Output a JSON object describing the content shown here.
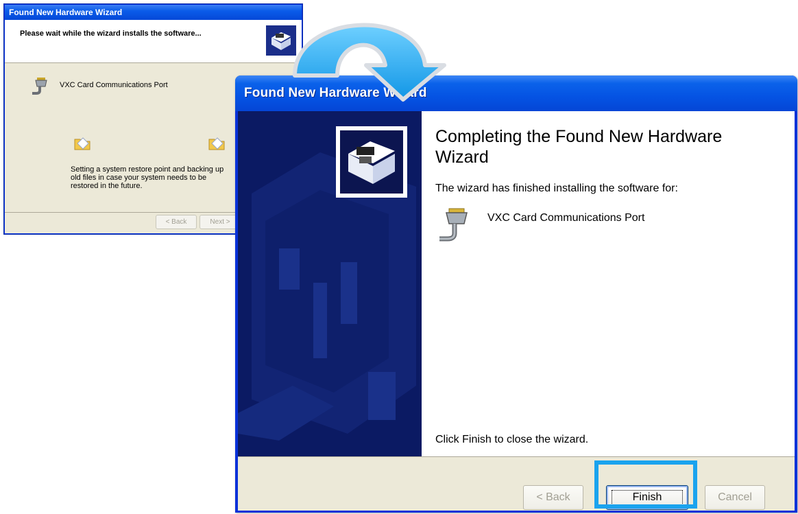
{
  "small_wizard": {
    "title": "Found New Hardware Wizard",
    "header": "Please wait while the wizard installs the software...",
    "device_name": "VXC Card Communications Port",
    "status": "Setting a system restore point and backing up old files in case your system needs to be restored in the future.",
    "back_label": "< Back",
    "next_label": "Next >"
  },
  "big_wizard": {
    "title": "Found New Hardware Wizard",
    "heading": "Completing the Found New Hardware Wizard",
    "description": "The wizard has finished installing the software for:",
    "device_name": "VXC Card Communications Port",
    "closing": "Click Finish to close the wizard.",
    "back_label": "< Back",
    "finish_label": "Finish",
    "cancel_label": "Cancel"
  },
  "colors": {
    "highlight": "#1aa3ee",
    "title_bar": "#0553e3",
    "sidebar": "#0b1a63"
  },
  "icons": [
    "serial-port-icon",
    "hardware-box-icon",
    "folder-icon",
    "transition-arrow-icon"
  ]
}
